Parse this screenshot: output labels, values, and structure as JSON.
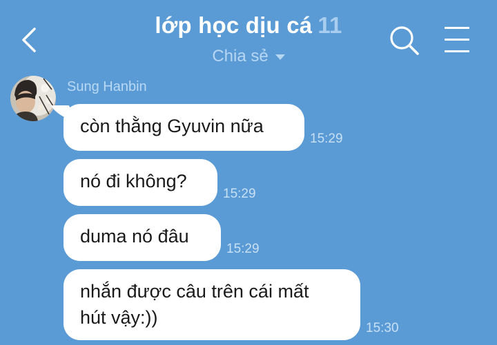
{
  "header": {
    "title": "lớp học dịu cá",
    "member_count": "11",
    "subtitle": "Chia sẻ",
    "icons": {
      "back": "chevron-left-icon",
      "search": "search-icon",
      "menu": "hamburger-menu-icon",
      "subtitle_caret": "caret-down-icon"
    }
  },
  "colors": {
    "background": "#5b9bd5",
    "bubble": "#ffffff",
    "title": "#ffffff",
    "muted_text": "#b7d6f2"
  },
  "chat": {
    "sender_name": "Sung Hanbin",
    "messages": [
      {
        "text": "còn thằng Gyuvin nữa",
        "time": "15:29"
      },
      {
        "text": "nó đi không?",
        "time": "15:29"
      },
      {
        "text": "duma nó đâu",
        "time": "15:29"
      },
      {
        "line1": "nhắn được câu trên cái mất",
        "line2": "hút vậy:))",
        "time": "15:30"
      }
    ]
  }
}
